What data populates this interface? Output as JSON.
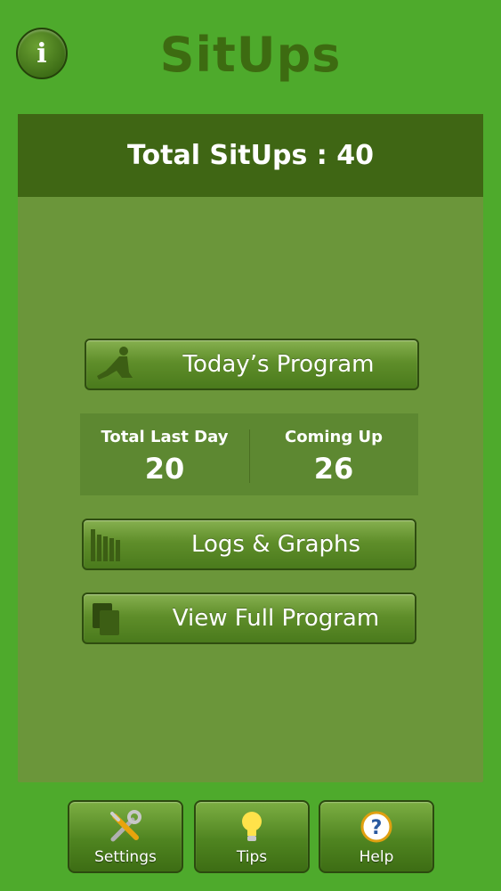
{
  "header": {
    "info_icon_glyph": "i",
    "title": "SitUps"
  },
  "summary": {
    "total_label": "Total SitUps : 40"
  },
  "menu": {
    "todays_program": "Today’s Program",
    "logs_graphs": "Logs & Graphs",
    "view_full_program": "View Full Program"
  },
  "stats": {
    "last_day_label": "Total Last Day",
    "last_day_value": "20",
    "coming_up_label": "Coming Up",
    "coming_up_value": "26"
  },
  "tabbar": {
    "items": [
      {
        "label": "Settings",
        "icon": "tools-icon"
      },
      {
        "label": "Tips",
        "icon": "lightbulb-icon"
      },
      {
        "label": "Help",
        "icon": "question-icon"
      }
    ]
  },
  "colors": {
    "background": "#4eaa2c",
    "panel": "#6b963a",
    "panel_header": "#3f6614",
    "title_text": "#3d6b11"
  }
}
